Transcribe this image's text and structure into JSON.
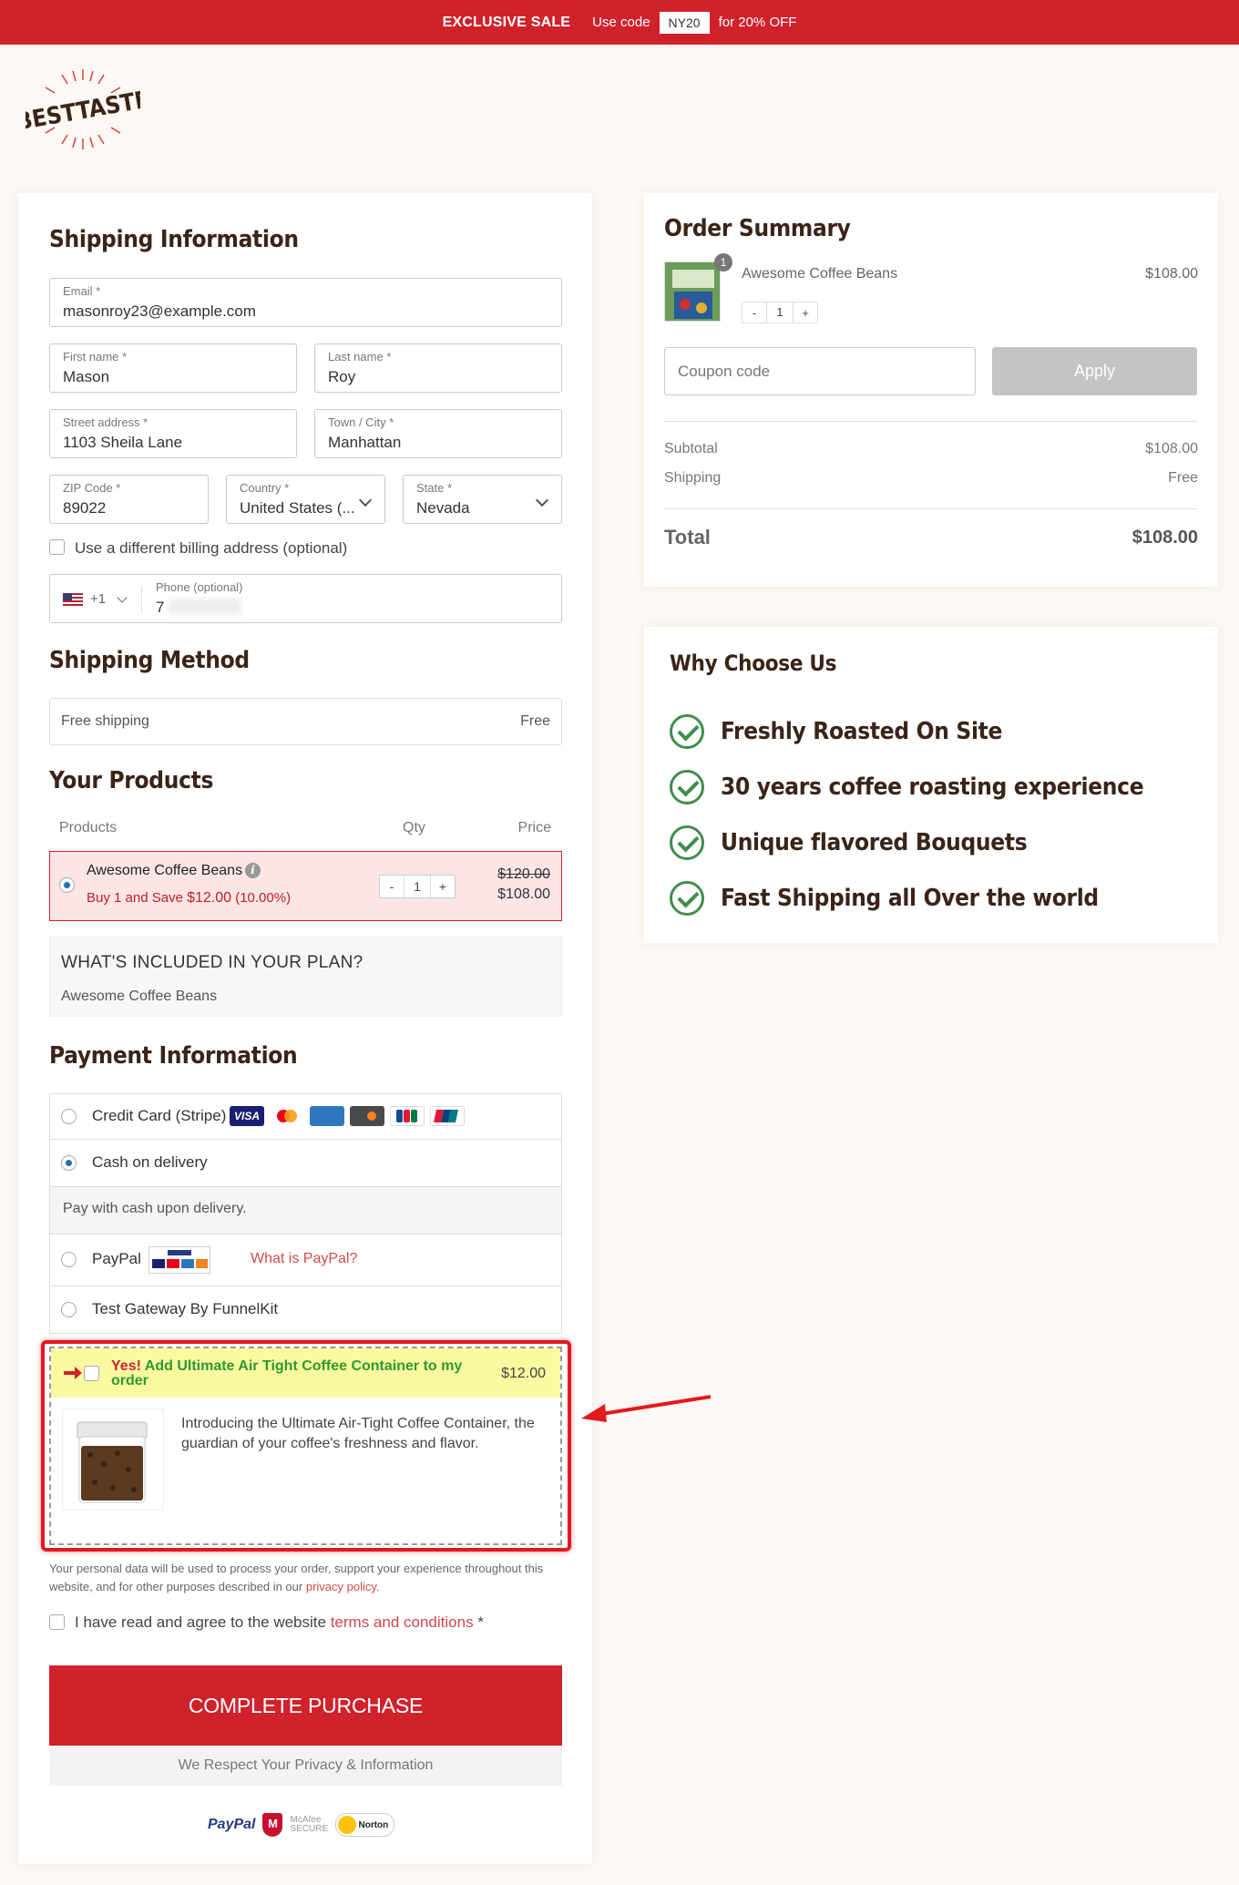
{
  "topbar": {
    "sale": "EXCLUSIVE SALE",
    "use_code": "Use code",
    "code": "NY20",
    "offer": "for 20% OFF"
  },
  "logo": {
    "text": "BESTTASTE"
  },
  "shipping": {
    "title": "Shipping Information",
    "email": {
      "label": "Email *",
      "value": "masonroy23@example.com"
    },
    "first_name": {
      "label": "First name *",
      "value": "Mason"
    },
    "last_name": {
      "label": "Last name *",
      "value": "Roy"
    },
    "street": {
      "label": "Street address *",
      "value": "1103 Sheila Lane"
    },
    "city": {
      "label": "Town / City *",
      "value": "Manhattan"
    },
    "zip": {
      "label": "ZIP Code *",
      "value": "89022"
    },
    "country": {
      "label": "Country *",
      "value": "United States (..."
    },
    "state": {
      "label": "State *",
      "value": "Nevada"
    },
    "billing_label": "Use a different billing address (optional)",
    "phone": {
      "code": "+1",
      "label": "Phone (optional)",
      "value": "7"
    }
  },
  "method": {
    "title": "Shipping Method",
    "name": "Free shipping",
    "price": "Free"
  },
  "products": {
    "title": "Your Products",
    "col_products": "Products",
    "col_qty": "Qty",
    "col_price": "Price",
    "item": {
      "name": "Awesome Coffee Beans",
      "promo_prefix": "Buy 1 and Save",
      "promo_amount": "$12.00",
      "promo_pct": "(10.00%)",
      "qty": "1",
      "old_price": "$120.00",
      "price": "$108.00",
      "minus": "-",
      "plus": "+"
    },
    "plan_title": "WHAT'S INCLUDED IN YOUR PLAN?",
    "plan_item": "Awesome Coffee Beans"
  },
  "payment": {
    "title": "Payment Information",
    "credit_card": "Credit Card (Stripe)",
    "cod": "Cash on delivery",
    "cod_desc": "Pay with cash upon delivery.",
    "paypal": "PayPal",
    "what_paypal": "What is PayPal?",
    "test": "Test Gateway By FunnelKit",
    "card_brands": [
      "VISA",
      "Mastercard",
      "American Express",
      "Discover",
      "JCB",
      "UnionPay"
    ]
  },
  "bump": {
    "yes": "Yes!",
    "title": "Add Ultimate Air Tight Coffee Container to my order",
    "price": "$12.00",
    "desc": "Introducing the Ultimate Air-Tight Coffee Container, the guardian of your coffee's freshness and flavor."
  },
  "privacy": {
    "text": "Your personal data will be used to process your order, support your experience throughout this website, and for other purposes described in our",
    "link": "privacy policy",
    "end": "."
  },
  "terms": {
    "text": "I have read and agree to the website",
    "link": "terms and conditions",
    "star": "*"
  },
  "cta": {
    "label": "COMPLETE PURCHASE",
    "note": "We Respect Your Privacy & Information"
  },
  "badges": {
    "paypal": "PayPal",
    "mcafee": "McAfee SECURE",
    "norton": "Norton"
  },
  "summary": {
    "title": "Order Summary",
    "badge": "1",
    "item": "Awesome Coffee Beans",
    "item_price": "$108.00",
    "qty": "1",
    "minus": "-",
    "plus": "+",
    "coupon_placeholder": "Coupon code",
    "apply": "Apply",
    "subtotal_label": "Subtotal",
    "subtotal": "$108.00",
    "shipping_label": "Shipping",
    "shipping": "Free",
    "total_label": "Total",
    "total": "$108.00"
  },
  "why": {
    "title": "Why Choose Us",
    "items": [
      "Freshly Roasted On Site",
      "30 years coffee roasting experience",
      "Unique flavored Bouquets",
      "Fast Shipping all Over the world"
    ]
  },
  "colors": {
    "brand_red": "#d0222b",
    "check_green": "#3f8e4b",
    "bump_yellow": "#fbf9a0"
  }
}
